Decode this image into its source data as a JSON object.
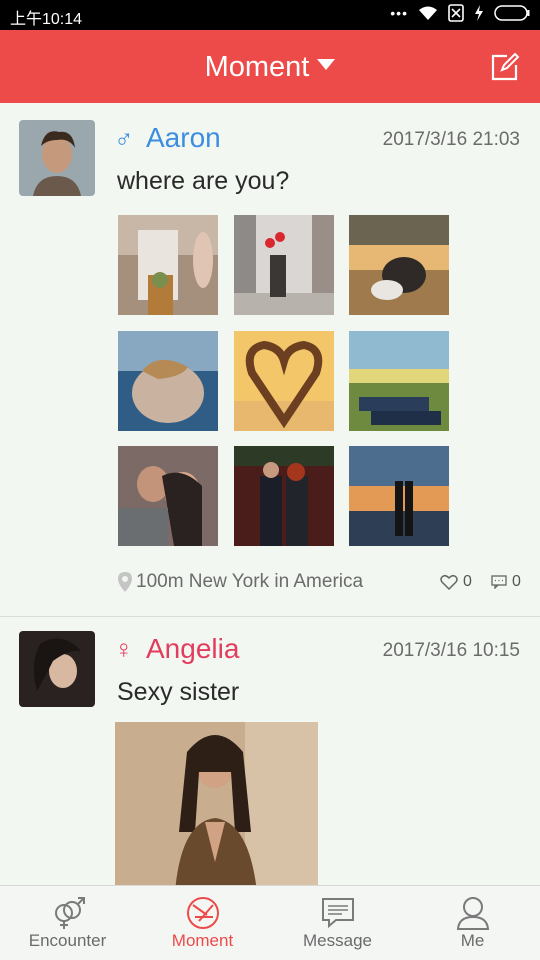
{
  "status_bar": {
    "time": "上午10:14",
    "dots": "•••"
  },
  "header": {
    "title": "Moment"
  },
  "posts": [
    {
      "gender_symbol": "♂",
      "name": "Aaron",
      "timestamp": "2017/3/16 21:03",
      "text": "where are you?",
      "location": "100m New York in America",
      "likes": "0",
      "comments": "0",
      "name_color": "#3d8ee0"
    },
    {
      "gender_symbol": "♀",
      "name": "Angelia",
      "timestamp": "2017/3/16 10:15",
      "text": "Sexy sister",
      "name_color": "#e23c5e"
    }
  ],
  "tabs": [
    {
      "label": "Encounter",
      "icon": "gender-icon"
    },
    {
      "label": "Moment",
      "icon": "moment-icon",
      "active": true
    },
    {
      "label": "Message",
      "icon": "message-icon"
    },
    {
      "label": "Me",
      "icon": "person-icon"
    }
  ],
  "colors": {
    "accent": "#ec4b4a",
    "male": "#3d8ee0",
    "female": "#e23c5e",
    "background": "#f2f7f1"
  }
}
